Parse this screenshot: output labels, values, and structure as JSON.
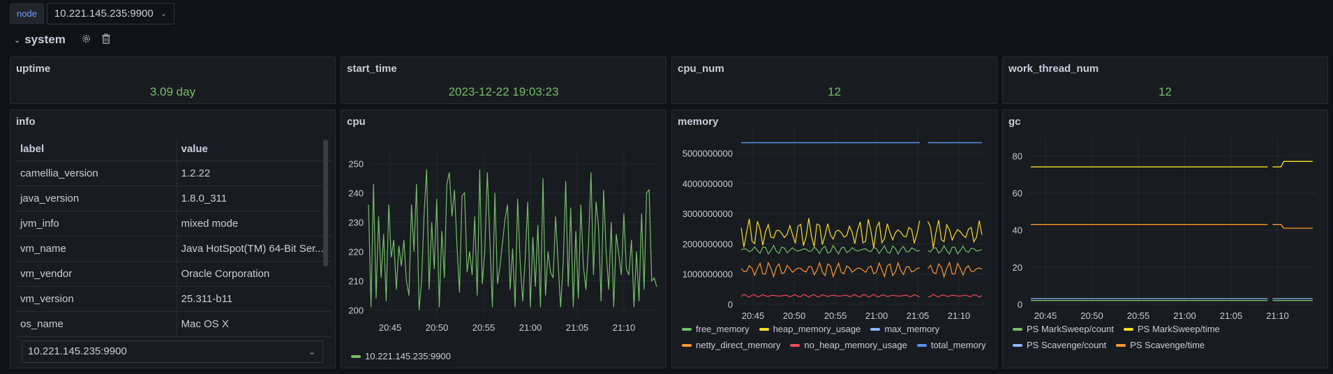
{
  "topbar": {
    "var_label": "node",
    "var_value": "10.221.145.235:9900"
  },
  "row": {
    "title": "system"
  },
  "stats": [
    {
      "title": "uptime",
      "value": "3.09 day"
    },
    {
      "title": "start_time",
      "value": "2023-12-22 19:03:23"
    },
    {
      "title": "cpu_num",
      "value": "12"
    },
    {
      "title": "work_thread_num",
      "value": "12"
    }
  ],
  "info": {
    "title": "info",
    "columns": [
      "label",
      "value"
    ],
    "rows": [
      [
        "camellia_version",
        "1.2.22"
      ],
      [
        "java_version",
        "1.8.0_311"
      ],
      [
        "jvm_info",
        "mixed mode"
      ],
      [
        "vm_name",
        "Java HotSpot(TM) 64-Bit Ser..."
      ],
      [
        "vm_vendor",
        "Oracle Corporation"
      ],
      [
        "vm_version",
        "25.311-b11"
      ],
      [
        "os_name",
        "Mac OS X"
      ]
    ],
    "select_value": "10.221.145.235:9900"
  },
  "colors": {
    "green": "#73bf69",
    "yellow": "#fade2a",
    "blue": "#8ab8ff",
    "orange": "#ff9830",
    "red": "#f2495c",
    "darkblue": "#5794f2"
  },
  "chart_data": [
    {
      "title": "cpu",
      "type": "line",
      "x_ticks": [
        "20:45",
        "20:50",
        "20:55",
        "21:00",
        "21:05",
        "21:10"
      ],
      "y_ticks": [
        "200",
        "210",
        "220",
        "230",
        "240",
        "250"
      ],
      "ylim": [
        198,
        252
      ],
      "series": [
        {
          "name": "10.221.145.235:9900",
          "color": "#73bf69",
          "values": [
            236,
            201,
            243,
            204,
            232,
            211,
            226,
            203,
            236,
            218,
            224,
            207,
            222,
            215,
            224,
            210,
            205,
            236,
            220,
            243,
            200,
            210,
            233,
            248,
            207,
            230,
            214,
            238,
            201,
            227,
            211,
            243,
            247,
            232,
            241,
            222,
            206,
            239,
            240,
            213,
            220,
            212,
            232,
            205,
            248,
            209,
            220,
            247,
            224,
            201,
            240,
            209,
            215,
            223,
            231,
            236,
            207,
            221,
            201,
            238,
            216,
            203,
            218,
            237,
            201,
            225,
            208,
            229,
            201,
            245,
            205,
            220,
            213,
            211,
            232,
            216,
            201,
            216,
            244,
            208,
            235,
            201,
            227,
            204,
            236,
            215,
            207,
            222,
            247,
            212,
            237,
            228,
            203,
            241,
            220,
            207,
            230,
            201,
            226,
            219,
            212,
            233,
            214,
            212,
            224,
            201,
            220,
            203,
            233,
            207,
            240,
            241,
            210,
            211,
            208
          ]
        }
      ]
    },
    {
      "title": "memory",
      "type": "line",
      "x_ticks": [
        "20:45",
        "20:50",
        "20:55",
        "21:00",
        "21:05",
        "21:10"
      ],
      "y_ticks": [
        "0",
        "1000000000",
        "2000000000",
        "3000000000",
        "4000000000",
        "5000000000"
      ],
      "ylim": [
        0,
        5500000000
      ],
      "series": [
        {
          "name": "free_memory",
          "color": "#73bf69",
          "base": 1800000000,
          "amp": 150000000
        },
        {
          "name": "heap_memory_usage",
          "color": "#fade2a",
          "base": 2350000000,
          "amp": 500000000
        },
        {
          "name": "max_memory",
          "color": "#8ab8ff",
          "base": 5350000000,
          "amp": 0
        },
        {
          "name": "netty_direct_memory",
          "color": "#ff9830",
          "base": 1150000000,
          "amp": 250000000
        },
        {
          "name": "no_heap_memory_usage",
          "color": "#f2495c",
          "base": 280000000,
          "amp": 50000000
        },
        {
          "name": "total_memory",
          "color": "#5794f2",
          "base": 5350000000,
          "amp": 0
        }
      ]
    },
    {
      "title": "gc",
      "type": "line",
      "x_ticks": [
        "20:45",
        "20:50",
        "20:55",
        "21:00",
        "21:05",
        "21:10"
      ],
      "y_ticks": [
        "0",
        "20",
        "40",
        "60",
        "80"
      ],
      "ylim": [
        0,
        85
      ],
      "series": [
        {
          "name": "PS MarkSweep/count",
          "color": "#73bf69",
          "before": 2,
          "after": 2
        },
        {
          "name": "PS MarkSweep/time",
          "color": "#fade2a",
          "before": 74,
          "after": 77
        },
        {
          "name": "PS Scavenge/count",
          "color": "#8ab8ff",
          "before": 3,
          "after": 3
        },
        {
          "name": "PS Scavenge/time",
          "color": "#ff9830",
          "before": 43,
          "after": 41
        }
      ]
    }
  ]
}
